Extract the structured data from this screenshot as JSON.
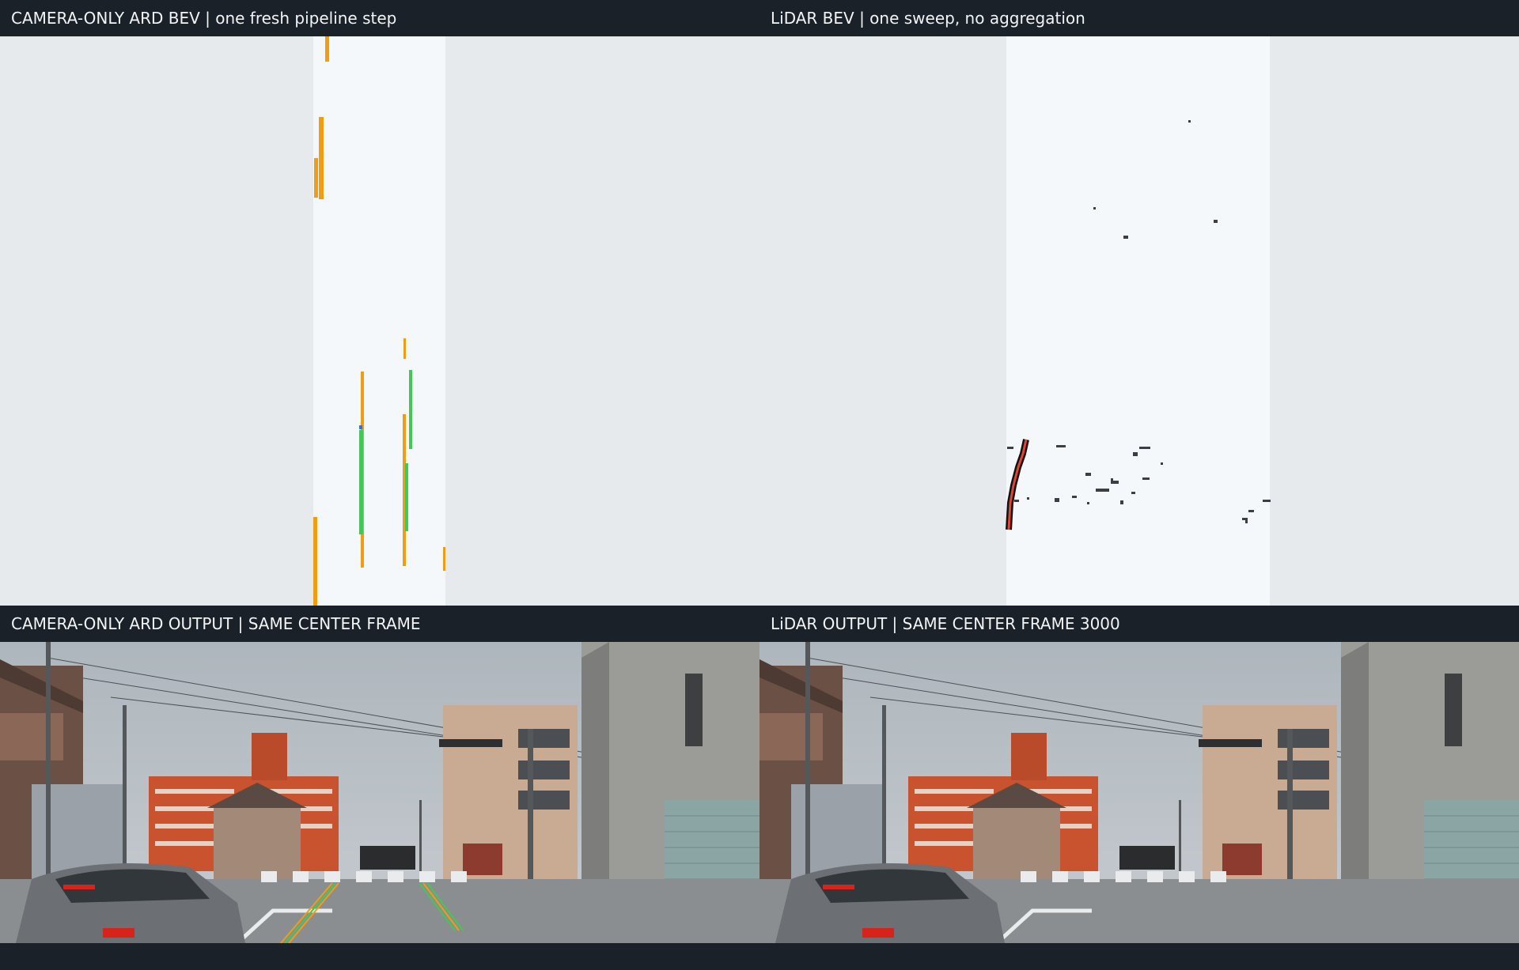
{
  "panels": {
    "camera_bev": {
      "title": "CAMERA-ONLY ARD BEV | one fresh pipeline step"
    },
    "lidar_bev": {
      "title": "LiDAR BEV | one sweep, no aggregation"
    },
    "camera_output": {
      "title": "CAMERA-ONLY ARD OUTPUT | SAME CENTER FRAME"
    },
    "lidar_output": {
      "title": "LiDAR OUTPUT | SAME CENTER FRAME 3000"
    }
  },
  "colors": {
    "header_bg": "#1a2129",
    "bev_background": "#e6eaed",
    "bev_strip": "#f5f8fa",
    "camera_lane_marks": "#f29c12",
    "camera_green_marks": "#44c755",
    "lidar_points": "#3a3f45",
    "lidar_curb": "#e0452f"
  }
}
